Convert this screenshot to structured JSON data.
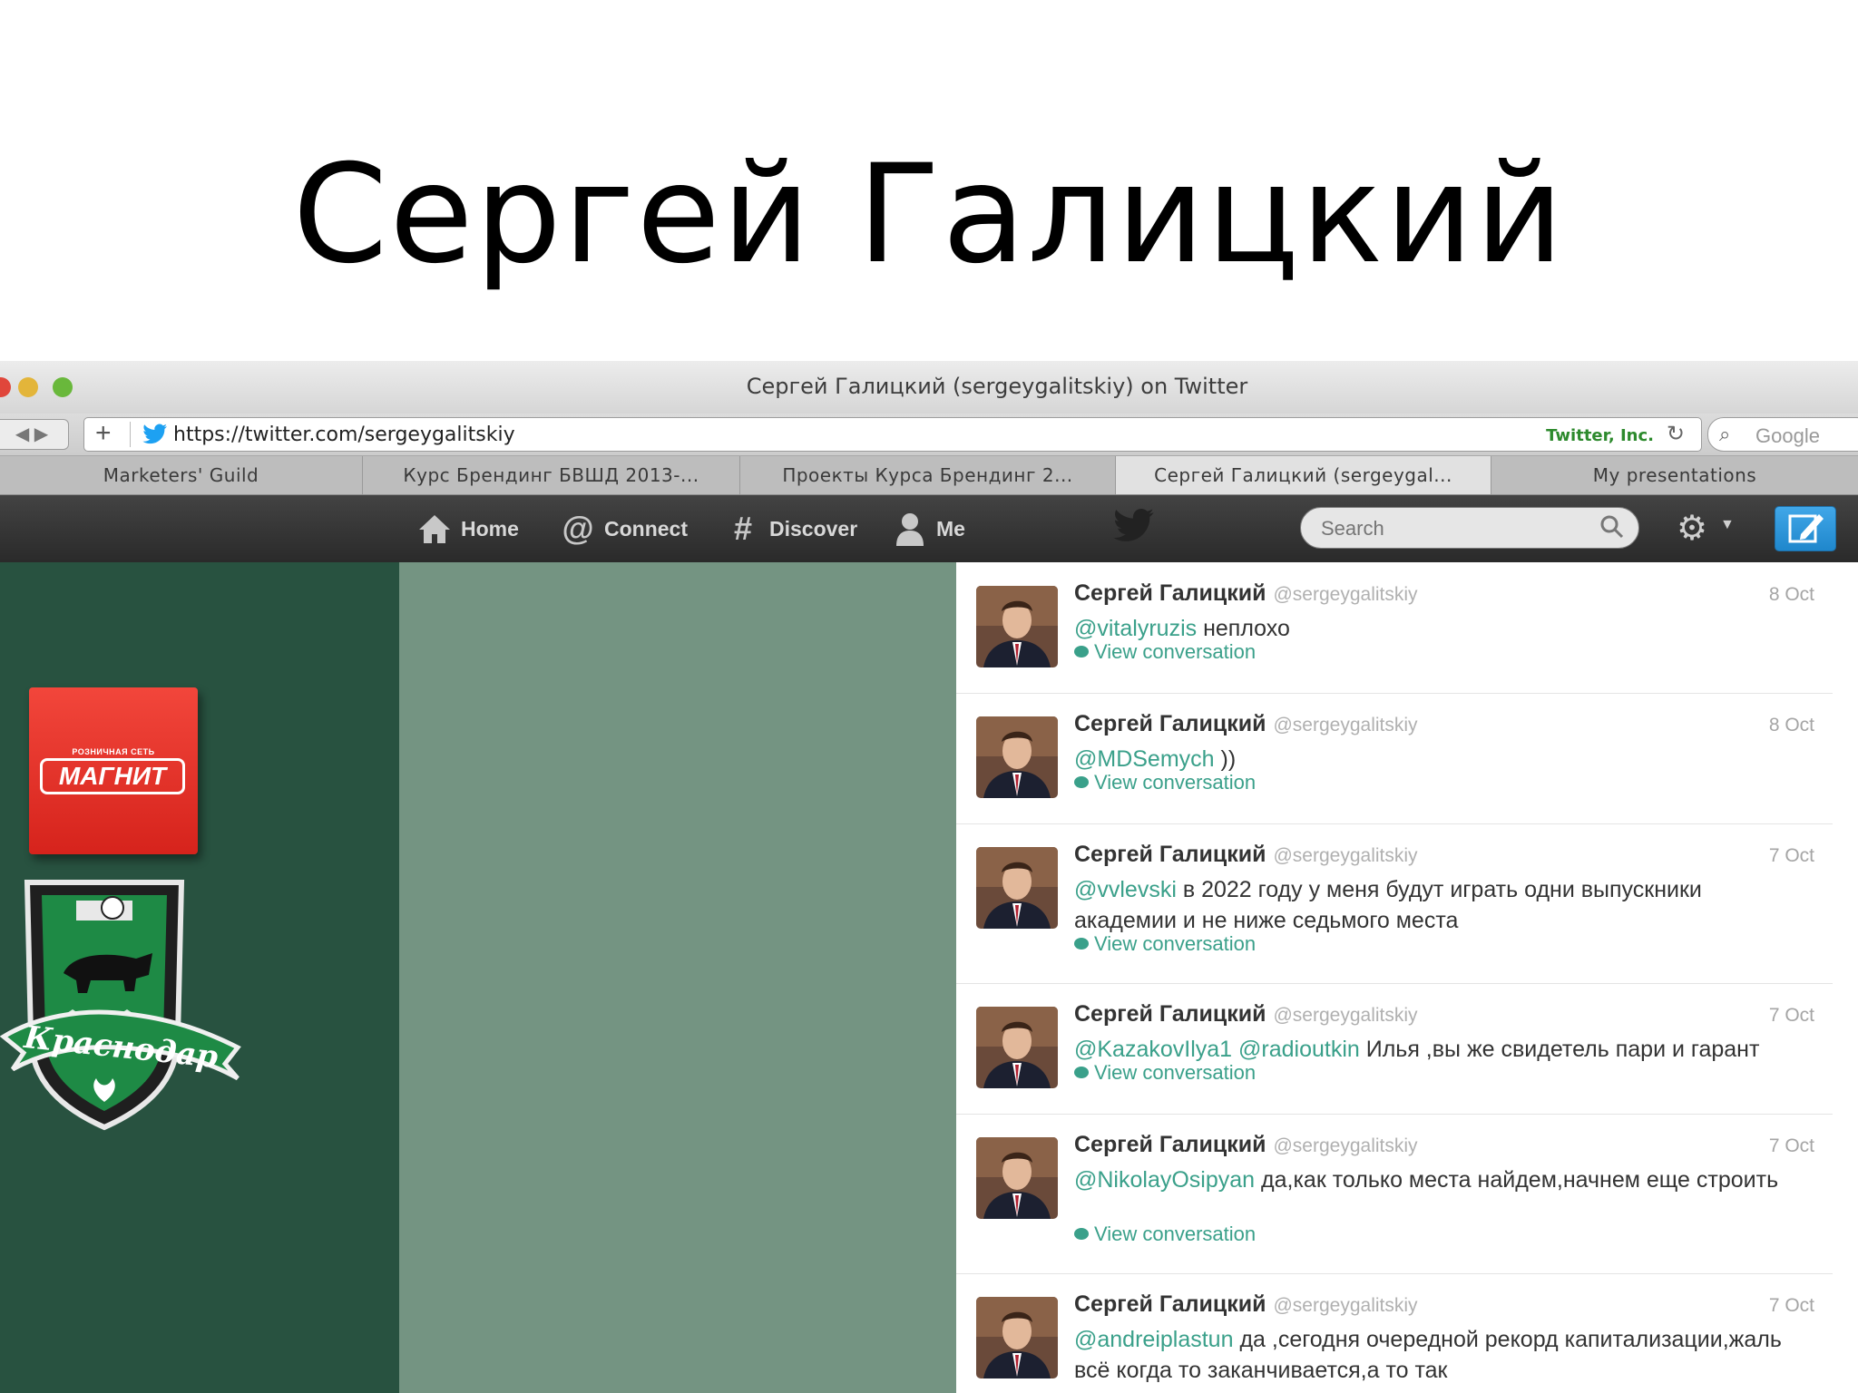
{
  "slide": {
    "title": "Сергей Галицкий"
  },
  "browser": {
    "window_title": "Сергей Галицкий (sergeygalitskiy) on Twitter",
    "url": "https://twitter.com/sergeygalitskiy",
    "cert_label": "Twitter, Inc.",
    "search_placeholder": "Google",
    "tabs": [
      {
        "label": "Marketers' Guild",
        "active": false
      },
      {
        "label": "Курс Брендинг БВШД 2013-...",
        "active": false
      },
      {
        "label": "Проекты Курса Брендинг 2...",
        "active": false
      },
      {
        "label": "Сергей Галицкий (sergeygal...",
        "active": true
      },
      {
        "label": "My presentations",
        "active": false
      }
    ]
  },
  "twitter_nav": {
    "items": [
      {
        "label": "Home",
        "icon": "home-icon"
      },
      {
        "label": "Connect",
        "icon": "at-icon"
      },
      {
        "label": "Discover",
        "icon": "hash-icon"
      },
      {
        "label": "Me",
        "icon": "user-icon"
      }
    ],
    "search_placeholder": "Search"
  },
  "sidebar": {
    "magnit_small": "РОЗНИЧНАЯ СЕТЬ",
    "magnit_name": "МАГНИТ",
    "club_name": "Краснодар"
  },
  "tweets": [
    {
      "name": "Сергей Галицкий",
      "handle": "@sergeygalitskiy",
      "date": "8 Oct",
      "mentions": "@vitalyruzis",
      "text": " неплохо",
      "view": "View conversation"
    },
    {
      "name": "Сергей Галицкий",
      "handle": "@sergeygalitskiy",
      "date": "8 Oct",
      "mentions": "@MDSemych",
      "text": " ))",
      "view": "View conversation"
    },
    {
      "name": "Сергей Галицкий",
      "handle": "@sergeygalitskiy",
      "date": "7 Oct",
      "mentions": "@vvlevski",
      "text": " в 2022 году у меня будут играть одни выпускники академии и не ниже седьмого места",
      "view": "View conversation"
    },
    {
      "name": "Сергей Галицкий",
      "handle": "@sergeygalitskiy",
      "date": "7 Oct",
      "mentions": "@KazakovIlya1 @radioutkin",
      "text": " Илья ,вы же свидетель пари и гарант",
      "view": "View conversation"
    },
    {
      "name": "Сергей Галицкий",
      "handle": "@sergeygalitskiy",
      "date": "7 Oct",
      "mentions": "@NikolayOsipyan",
      "text": " да,как только места найдем,начнем еще строить",
      "view": "View conversation"
    },
    {
      "name": "Сергей Галицкий",
      "handle": "@sergeygalitskiy",
      "date": "7 Oct",
      "mentions": "@andreiplastun",
      "text": " да ,сегодня очередной рекорд капитализации,жаль всё когда то заканчивается,а то так",
      "view": ""
    }
  ]
}
